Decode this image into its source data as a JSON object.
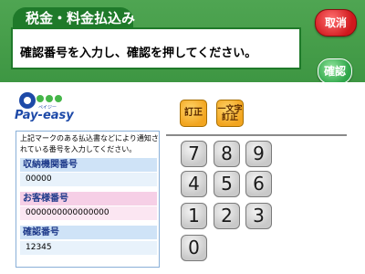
{
  "header": {
    "title": "税金・料金払込み",
    "instruction": "確認番号を入力し、確認を押してください。",
    "cancel_label": "取消",
    "confirm_label": "確認"
  },
  "logo": {
    "text": "Pay-easy",
    "subtext": "ペイジー"
  },
  "info": {
    "note": "上記マークのある払込書などにより通知されている番号を入力してください。",
    "fields": [
      {
        "label": "収納機関番号",
        "value": "00000"
      },
      {
        "label": "お客様番号",
        "value": "0000000000000000"
      },
      {
        "label": "確認番号",
        "value": "12345"
      }
    ]
  },
  "function_keys": {
    "correct_label": "訂正",
    "backspace_line1": "一文字",
    "backspace_line2": "訂正"
  },
  "keypad": {
    "keys": [
      "7",
      "8",
      "9",
      "4",
      "5",
      "6",
      "1",
      "2",
      "3",
      "0"
    ]
  },
  "colors": {
    "header_green": "#2f8a36",
    "cancel_red": "#d0181d",
    "confirm_green": "#2fa64a",
    "function_orange": "#f2a520",
    "field_label_blue": "#cfe3f7",
    "field_label_pink": "#f6cfe6"
  }
}
